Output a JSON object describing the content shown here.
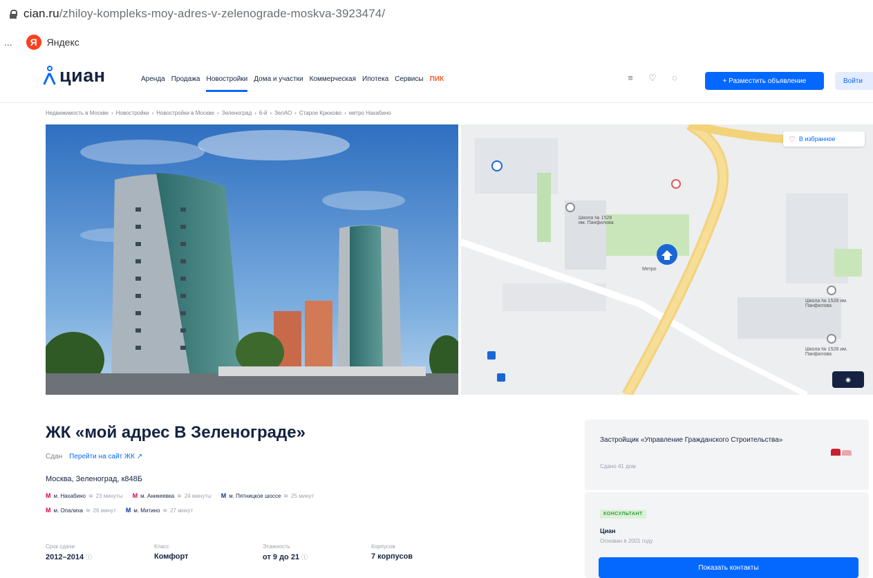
{
  "browser": {
    "url_domain": "cian.ru",
    "url_path": "/zhiloy-kompleks-moy-adres-v-zelenograde-moskva-3923474/",
    "bookmark_more": "...",
    "bookmark_yandex": "Яндекс",
    "yandex_logo_letter": "Я"
  },
  "header": {
    "logo_text": "циан",
    "nav": [
      "Аренда",
      "Продажа",
      "Новостройки",
      "Дома и участки",
      "Коммерческая",
      "Ипотека",
      "Сервисы"
    ],
    "nav_active_index": 2,
    "pik_label": "ПИК",
    "post_button": "+ Разместить объявление",
    "login_button": "Войти",
    "icons": [
      "compare-icon",
      "heart-icon",
      "bell-icon"
    ]
  },
  "breadcrumbs": [
    "Недвижимость в Москве",
    "Новостройки",
    "Новостройки в Москве",
    "Зеленоград",
    "6-й",
    "ЗелАО",
    "Старое Крюково",
    "метро Нахабино"
  ],
  "breadcrumb_separator": "›",
  "gallery": {
    "favorite_label": "В избранное",
    "map_labels": [
      "Школа № 1528 им. Панфилова",
      "Метро",
      "Школа № 1528 им. Панфилова",
      "Школа № 1528 им. Панфилова"
    ]
  },
  "listing": {
    "title": "ЖК «мой адрес В Зеленограде»",
    "status": "Сдан",
    "site_link": "Перейти на сайт ЖК ↗",
    "address": "Москва, Зеленоград, к848Б",
    "metro_row1": [
      {
        "name": "м. Нахабино",
        "time": "23 минуты",
        "color": "#d6083b"
      },
      {
        "name": "м. Аникеевка",
        "time": "24 минуты",
        "color": "#d6083b"
      },
      {
        "name": "м. Пятницкое шоссе",
        "time": "25 минут",
        "color": "#0f2fa6"
      }
    ],
    "metro_row2": [
      {
        "name": "м. Опалиха",
        "time": "26 минут",
        "color": "#d6083b"
      },
      {
        "name": "м. Митино",
        "time": "27 минут",
        "color": "#0f2fa6"
      }
    ],
    "metro_letter": "М",
    "walk_icon": "≋",
    "specs": [
      {
        "label": "Срок сдачи",
        "value": "2012–2014",
        "info": "ⓘ"
      },
      {
        "label": "Класс",
        "value": "Комфорт",
        "info": ""
      },
      {
        "label": "Этажность",
        "value": "от 9 до 21",
        "info": "ⓘ"
      },
      {
        "label": "Корпусов",
        "value": "7 корпусов",
        "info": ""
      }
    ]
  },
  "developer": {
    "name": "Застройщик «Управление Гражданского Строительства»",
    "sub": "Сдано 41 дом"
  },
  "consultant": {
    "badge": "КОНСУЛЬТАНТ",
    "name": "Циан",
    "sub": "Основан в 2001 году",
    "contacts_button": "Показать контакты"
  },
  "colors": {
    "brand": "#0468ff",
    "text": "#152242",
    "pik": "#ff5e2c"
  }
}
